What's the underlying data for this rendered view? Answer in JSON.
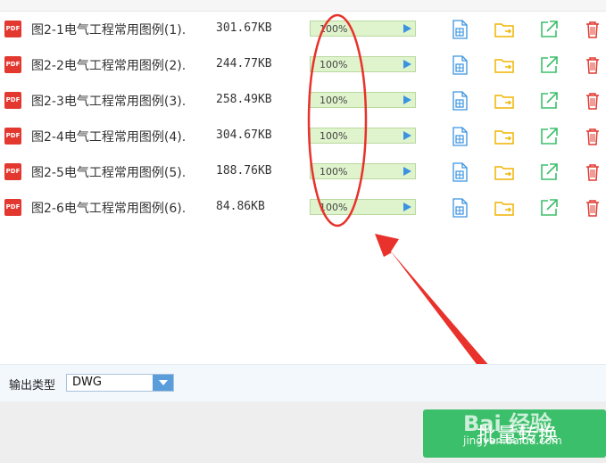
{
  "files": [
    {
      "name": "图2-1电气工程常用图例(1).",
      "size": "301.67KB",
      "progress": "100%"
    },
    {
      "name": "图2-2电气工程常用图例(2).",
      "size": "244.77KB",
      "progress": "100%"
    },
    {
      "name": "图2-3电气工程常用图例(3).",
      "size": "258.49KB",
      "progress": "100%"
    },
    {
      "name": "图2-4电气工程常用图例(4).",
      "size": "304.67KB",
      "progress": "100%"
    },
    {
      "name": "图2-5电气工程常用图例(5).",
      "size": "188.76KB",
      "progress": "100%"
    },
    {
      "name": "图2-6电气工程常用图例(6).",
      "size": "84.86KB",
      "progress": "100%"
    }
  ],
  "file_badge": "PDF",
  "output": {
    "label": "输出类型",
    "selected": "DWG"
  },
  "convert_button": {
    "label": "批量转换"
  },
  "watermark": {
    "text": "Bai 经验",
    "url": "jingyan.baidu.com"
  },
  "colors": {
    "accent_blue": "#3a93e0",
    "folder": "#f0b400",
    "export": "#3bbf6a",
    "delete": "#e2382f",
    "progress_bg": "#dff3cc",
    "annotation": "#e8322b"
  },
  "icons": {
    "preview": "document-preview-icon",
    "folder": "folder-open-icon",
    "export": "external-link-icon",
    "delete": "trash-icon",
    "play": "play-icon"
  }
}
